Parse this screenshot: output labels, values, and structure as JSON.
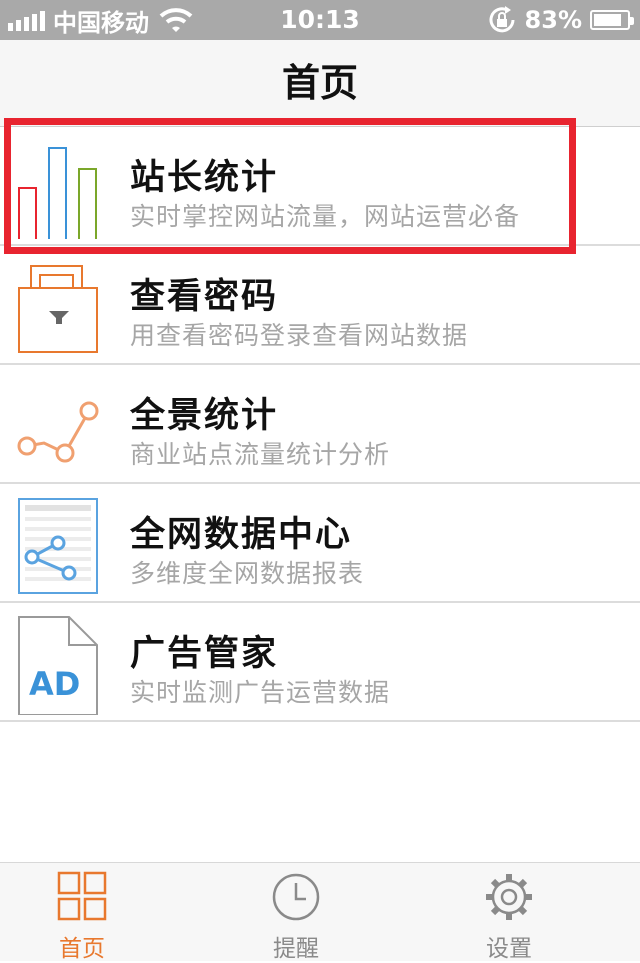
{
  "status_bar": {
    "carrier": "中国移动",
    "time": "10:13",
    "battery": "83%",
    "battery_level": 0.83
  },
  "nav": {
    "title": "首页"
  },
  "items": [
    {
      "title": "站长统计",
      "subtitle": "实时掌控网站流量，网站运营必备",
      "icon": "bar-chart-icon"
    },
    {
      "title": "查看密码",
      "subtitle": "用查看密码登录查看网站数据",
      "icon": "padlock-icon"
    },
    {
      "title": "全景统计",
      "subtitle": "商业站点流量统计分析",
      "icon": "line-graph-icon"
    },
    {
      "title": "全网数据中心",
      "subtitle": "多维度全网数据报表",
      "icon": "data-share-icon"
    },
    {
      "title": "广告管家",
      "subtitle": "实时监测广告运营数据",
      "icon": "ad-document-icon"
    }
  ],
  "tabs": [
    {
      "label": "首页",
      "icon": "grid-icon",
      "active": true
    },
    {
      "label": "提醒",
      "icon": "clock-icon",
      "active": false
    },
    {
      "label": "设置",
      "icon": "gear-icon",
      "active": false
    }
  ],
  "colors": {
    "accent": "#e8782e",
    "inactive": "#8a8a8a",
    "highlight": "#e8242f"
  }
}
